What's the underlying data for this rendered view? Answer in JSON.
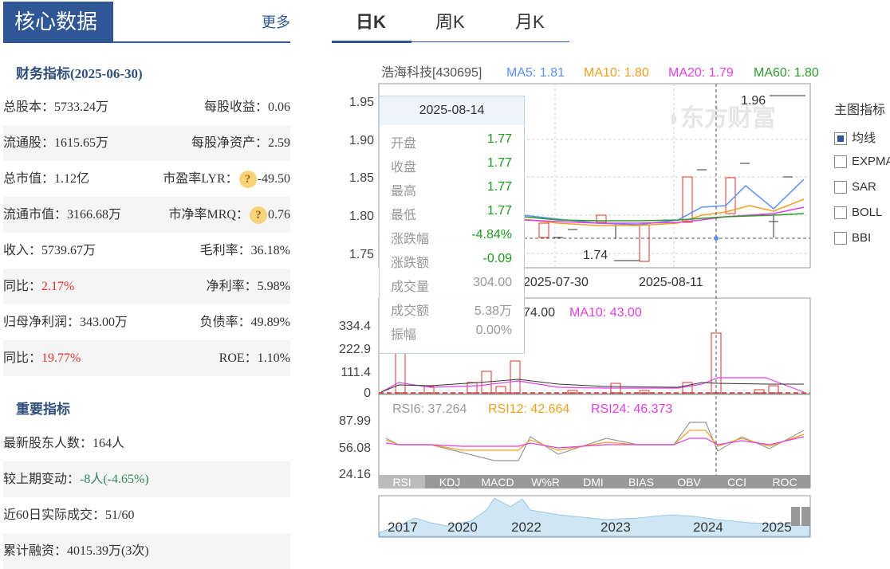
{
  "panel": {
    "title": "核心数据",
    "more": "更多"
  },
  "fin": {
    "title": "财务指标(2025-06-30)",
    "rows": [
      {
        "l": "总股本：5733.24万",
        "r": "每股收益：0.06"
      },
      {
        "l": "流通股：1615.65万",
        "r": "每股净资产：2.59"
      },
      {
        "l": "总市值：1.12亿",
        "r_label": "市盈率LYR：",
        "r_q": "?",
        "r_val": "-49.50"
      },
      {
        "l": "流通市值：3166.68万",
        "r_label": "市净率MRQ：",
        "r_q": "?",
        "r_val": "0.76"
      },
      {
        "l": "收入：5739.67万",
        "r": "毛利率：36.18%"
      },
      {
        "l_label": "同比：",
        "l_val": "2.17%",
        "r": "净利率：5.98%"
      },
      {
        "l": "归母净利润：343.00万",
        "r": "负债率：49.89%"
      },
      {
        "l_label": "同比：",
        "l_val": "19.77%",
        "r": "ROE：1.10%"
      }
    ]
  },
  "key": {
    "title": "重要指标",
    "rows": [
      {
        "t": "最新股东人数：164人"
      },
      {
        "label": "较上期变动：",
        "val": "-8人(-4.65%)"
      },
      {
        "t": "近60日实际成交：51/60"
      },
      {
        "t": "累计融资：4015.39万(3次)"
      }
    ]
  },
  "tabs": [
    "日K",
    "周K",
    "月K"
  ],
  "chart_header": {
    "name": "浩海科技[430695]",
    "ma5": "MA5: 1.81",
    "ma10": "MA10: 1.80",
    "ma20": "MA20: 1.79",
    "ma60": "MA60: 1.80"
  },
  "watermark": "东方财富",
  "price_axis": [
    "1.95",
    "1.90",
    "1.85",
    "1.80",
    "1.75"
  ],
  "price_notes": {
    "high": "1.96",
    "low": "1.74"
  },
  "date_labels": [
    "2025-07-30",
    "2025-08-11"
  ],
  "vol_header": {
    "ma5": "74.00",
    "ma10": "MA10: 43.00"
  },
  "vol_axis": [
    "334.4",
    "222.9",
    "111.4",
    "0"
  ],
  "rsi_header": {
    "rsi6": "RSI6: 37.264",
    "rsi12": "RSI12: 42.664",
    "rsi24": "RSI24: 46.373"
  },
  "rsi_axis": [
    "87.99",
    "56.08",
    "24.16"
  ],
  "indicator_tabs": [
    "RSI",
    "KDJ",
    "MACD",
    "W%R",
    "DMI",
    "BIAS",
    "OBV",
    "CCI",
    "ROC"
  ],
  "timeline_years": [
    "2017",
    "2020",
    "2022",
    "2023",
    "2024",
    "2025"
  ],
  "tooltip": {
    "date": "2025-08-14",
    "rows": [
      {
        "k": "开盘",
        "v": "1.77"
      },
      {
        "k": "收盘",
        "v": "1.77"
      },
      {
        "k": "最高",
        "v": "1.77"
      },
      {
        "k": "最低",
        "v": "1.77"
      },
      {
        "k": "涨跌幅",
        "v": "-4.84%"
      },
      {
        "k": "涨跌额",
        "v": "-0.09"
      },
      {
        "k": "成交量",
        "v": "304.00"
      },
      {
        "k": "成交额",
        "v": "5.38万"
      },
      {
        "k": "振幅",
        "v": "0.00%"
      }
    ]
  },
  "indicators": {
    "title": "主图指标",
    "items": [
      "均线",
      "EXPMA",
      "SAR",
      "BOLL",
      "BBI"
    ],
    "checked": "均线"
  },
  "colors": {
    "brand": "#2f5796",
    "up": "#e0312b",
    "down": "#1a9c1a",
    "ma5": "#5b8ff9",
    "ma10": "#f0a020",
    "ma20": "#e040e0",
    "ma60": "#2e9a2e"
  }
}
